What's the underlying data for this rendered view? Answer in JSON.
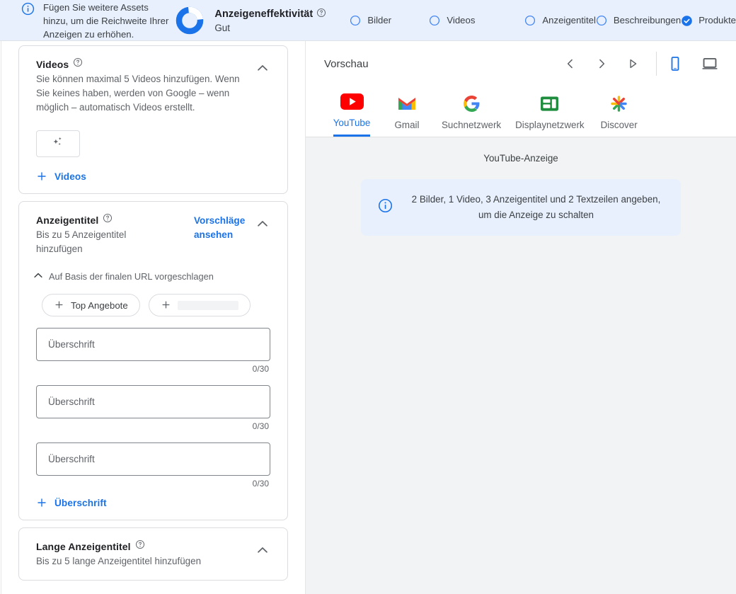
{
  "banner": {
    "icon": "info-icon",
    "text": "Fügen Sie weitere Assets hinzu, um die Reichweite Ihrer Anzeigen zu erhöhen.",
    "background": "#e8f0fe"
  },
  "effectiveness": {
    "icon": "progress-ring-icon",
    "title": "Anzeigeneffektivität",
    "help_icon": "help-icon",
    "rating": "Gut",
    "ring_percent": 75,
    "ring_color": "#1a73e8"
  },
  "asset_checks": [
    {
      "label": "Bilder",
      "checked": false
    },
    {
      "label": "Videos",
      "checked": false
    },
    {
      "label": "Anzeigentitel",
      "checked": false
    },
    {
      "label": "Beschreibungen",
      "checked": false
    },
    {
      "label": "Produkte",
      "checked": true
    }
  ],
  "cards": {
    "videos": {
      "title": "Videos",
      "help_icon": "help-icon",
      "description": "Sie können maximal 5 Videos hinzufügen. Wenn Sie keines haben, werden von Google – wenn möglich – automatisch Videos erstellt.",
      "collapse_icon": "chevron-up-icon",
      "ai_icon": "sparkle-icon",
      "add_label": "Videos",
      "add_icon": "plus-icon"
    },
    "headlines": {
      "title": "Anzeigentitel",
      "help_icon": "help-icon",
      "description": "Bis zu 5 Anzeigentitel hinzufügen",
      "suggestions_link": "Vorschläge ansehen",
      "collapse_icon": "chevron-up-icon",
      "suggested_section": {
        "label": "Auf Basis der finalen URL vorgeschlagen",
        "icon": "chevron-up-icon",
        "chips": [
          {
            "label": "Top Angebote",
            "icon": "plus-icon",
            "loading": false
          },
          {
            "label": "",
            "icon": "plus-icon",
            "loading": true
          }
        ]
      },
      "fields": [
        {
          "placeholder": "Überschrift",
          "value": "",
          "counter": "0/30"
        },
        {
          "placeholder": "Überschrift",
          "value": "",
          "counter": "0/30"
        },
        {
          "placeholder": "Überschrift",
          "value": "",
          "counter": "0/30"
        }
      ],
      "add_label": "Überschrift",
      "add_icon": "plus-icon"
    },
    "long_headlines": {
      "title": "Lange Anzeigentitel",
      "help_icon": "help-icon",
      "description": "Bis zu 5 lange Anzeigentitel hinzufügen",
      "collapse_icon": "chevron-up-icon"
    }
  },
  "preview": {
    "title": "Vorschau",
    "nav": [
      {
        "name": "previous",
        "icon": "chevron-left-icon"
      },
      {
        "name": "next",
        "icon": "chevron-right-icon"
      },
      {
        "name": "play",
        "icon": "play-icon"
      }
    ],
    "devices": [
      {
        "name": "mobile",
        "icon": "mobile-icon",
        "active": true
      },
      {
        "name": "desktop",
        "icon": "desktop-icon",
        "active": false
      }
    ],
    "tabs": [
      {
        "label": "YouTube",
        "icon": "youtube-icon",
        "active": true
      },
      {
        "label": "Gmail",
        "icon": "gmail-icon",
        "active": false
      },
      {
        "label": "Suchnetzwerk",
        "icon": "google-icon",
        "active": false
      },
      {
        "label": "Displaynetzwerk",
        "icon": "display-network-icon",
        "active": false
      },
      {
        "label": "Discover",
        "icon": "discover-icon",
        "active": false
      }
    ],
    "ad_kind": "YouTube-Anzeige",
    "notice": {
      "icon": "info-icon",
      "text": "2 Bilder, 1 Video, 3 Anzeigentitel und 2 Textzeilen angeben, um die Anzeige zu schalten",
      "background": "#e8f0fe"
    }
  }
}
